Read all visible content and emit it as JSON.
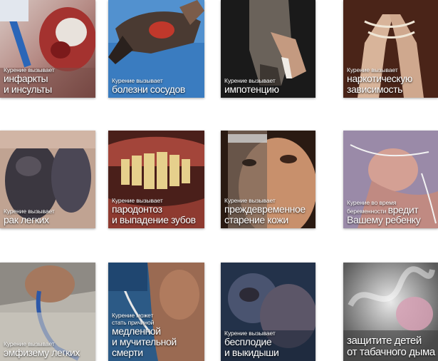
{
  "tiles": [
    {
      "small": "Курение вызывает",
      "big": "инфаркты\nи инсульты"
    },
    {
      "small": "Курение вызывает",
      "big": "болезни сосудов"
    },
    {
      "small": "Курение вызывает",
      "big": "импотенцию"
    },
    {
      "small": "Курение вызывает",
      "big": "наркотическую\nзависимость"
    },
    {
      "small": "Курение вызывает",
      "big": "рак легких"
    },
    {
      "small": "Курение вызывает",
      "big": "пародонтоз\nи выпадение зубов"
    },
    {
      "small": "Курение вызывает",
      "big": "преждевременное\nстарение кожи"
    },
    {
      "small_a": "Курение во время",
      "small_b": "беременности",
      "big_inline": "вредит",
      "big": "Вашему ребенку"
    },
    {
      "small": "Курение вызывает",
      "big": "эмфизему легких"
    },
    {
      "small": "Курение может\nстать причиной",
      "big": "медленной\nи мучительной\nсмерти"
    },
    {
      "small": "Курение вызывает",
      "big": "бесплодие\nи выкидыши"
    },
    {
      "small": "",
      "big": "защитите детей\nот табачного дыма"
    }
  ]
}
